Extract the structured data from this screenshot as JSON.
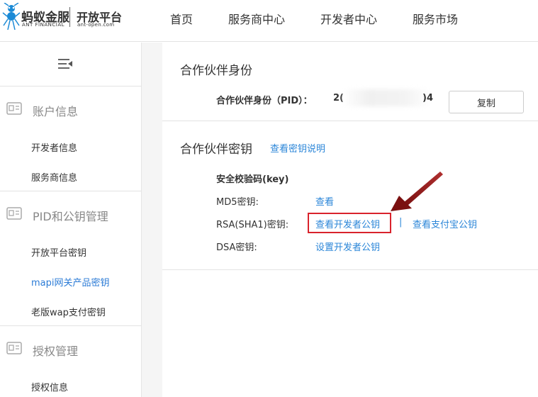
{
  "header": {
    "logo_main": "蚂蚁金服",
    "logo_sub": "ANT FINANCIAL",
    "platform": "开放平台",
    "platform_url": "ant-open.com",
    "nav": [
      "首页",
      "服务商中心",
      "开发者中心",
      "服务市场"
    ]
  },
  "sidebar": {
    "groups": [
      {
        "title": "账户信息",
        "items": [
          "开发者信息",
          "服务商信息"
        ]
      },
      {
        "title": "PID和公钥管理",
        "items": [
          "开放平台密钥",
          "mapi网关产品密钥",
          "老版wap支付密钥"
        ]
      },
      {
        "title": "授权管理",
        "items": [
          "授权信息"
        ]
      }
    ],
    "active_item": "mapi网关产品密钥"
  },
  "identity": {
    "section_title": "合作伙伴身份",
    "pid_label": "合作伙伴身份（PID）：",
    "pid_prefix": "2(",
    "pid_suffix": ")4",
    "copy_label": "复制"
  },
  "keys": {
    "section_title": "合作伙伴密钥",
    "help_link": "查看密钥说明",
    "heading": "安全校验码(key)",
    "md5_label": "MD5密钥:",
    "md5_link": "查看",
    "rsa_label": "RSA(SHA1)密钥:",
    "rsa_dev_link": "查看开发者公钥",
    "separator": "|",
    "rsa_alipay_link": "查看支付宝公钥",
    "dsa_label": "DSA密钥:",
    "dsa_link": "设置开发者公钥"
  },
  "colors": {
    "link": "#2b86d8",
    "active_menu": "#2b7bd6",
    "highlight": "#d9232c",
    "arrow": "#8b1a1a"
  }
}
